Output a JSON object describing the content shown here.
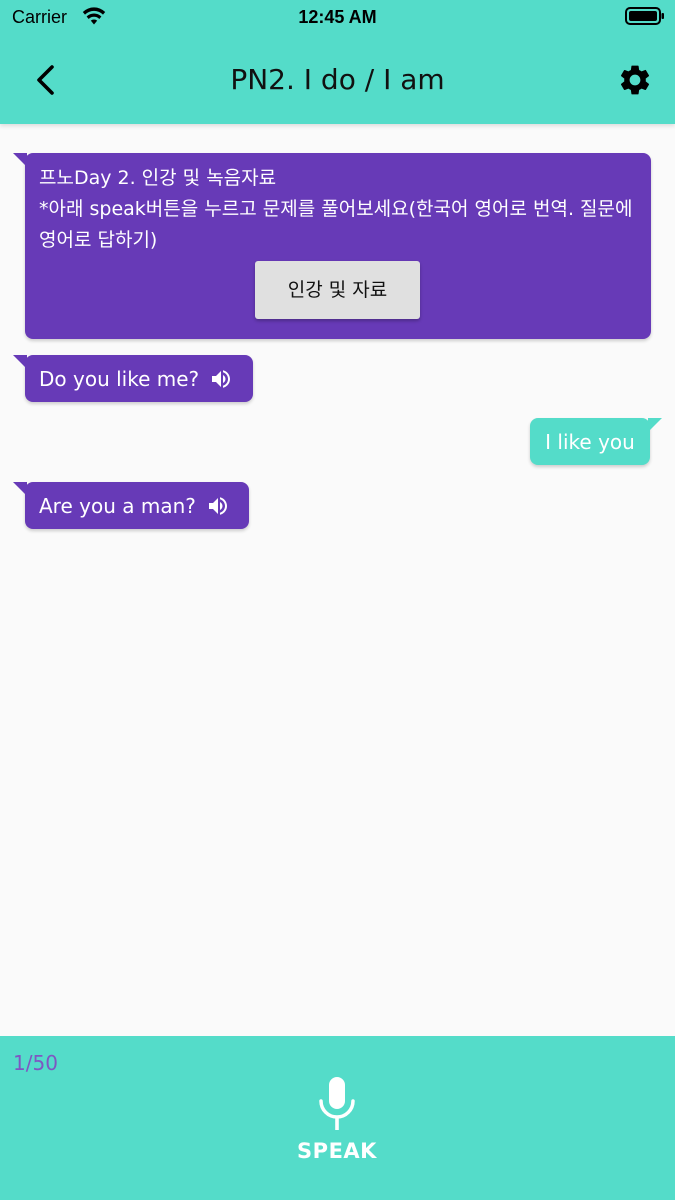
{
  "status_bar": {
    "carrier": "Carrier",
    "time": "12:45 AM"
  },
  "app_bar": {
    "title": "PN2. I do / I am",
    "back_icon": "chevron-left-icon",
    "settings_icon": "gear-icon"
  },
  "chat": {
    "intro": {
      "title": "프노Day 2. 인강 및 녹음자료",
      "body": "*아래 speak버튼을 누르고 문제를 풀어보세요(한국어 영어로 번역. 질문에 영어로 답하기)",
      "button_label": "인강 및 자료"
    },
    "messages": [
      {
        "sender": "bot",
        "text": "Do you like me?",
        "icon": "speaker-icon"
      },
      {
        "sender": "user",
        "text": "I like you"
      },
      {
        "sender": "bot",
        "text": "Are you a man?",
        "icon": "speaker-icon"
      }
    ]
  },
  "bottom_bar": {
    "progress": "1/50",
    "speak_label": "SPEAK",
    "mic_icon": "microphone-icon"
  },
  "colors": {
    "teal": "#54dcc9",
    "purple": "#673ab7",
    "counter_purple": "#7e57c2",
    "button_gray": "#e0e0e0"
  }
}
